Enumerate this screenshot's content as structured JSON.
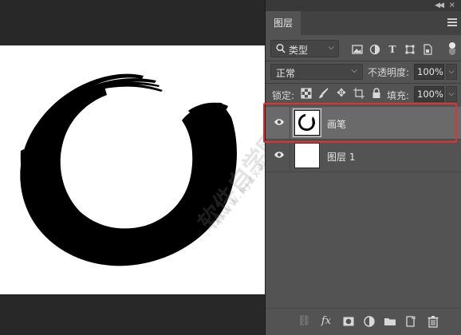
{
  "panel": {
    "tab_label": "图层",
    "filter": {
      "label": "类型"
    },
    "blend_mode": "正常",
    "opacity_label": "不透明度:",
    "opacity_value": "100%",
    "lock_label": "锁定:",
    "fill_label": "填充:",
    "fill_value": "100%",
    "layers": [
      {
        "name": "画笔",
        "selected": true,
        "visible": true
      },
      {
        "name": "图层 1",
        "selected": false,
        "visible": true
      }
    ]
  },
  "icons": {
    "filter": [
      "image-filter-icon",
      "adjustment-filter-icon",
      "type-filter-icon",
      "shape-filter-icon",
      "smart-object-filter-icon"
    ],
    "lock": [
      "lock-transparent-pixels-icon",
      "lock-image-pixels-icon",
      "lock-position-icon",
      "lock-artboard-icon",
      "lock-all-icon"
    ],
    "bottom": [
      "link-layers-icon",
      "layer-style-icon",
      "add-mask-icon",
      "adjustment-layer-icon",
      "new-group-icon",
      "new-layer-icon",
      "delete-layer-icon"
    ]
  },
  "watermark": {
    "text": "软件自学网",
    "sub": "WWW.RJZXW.COM"
  },
  "colors": {
    "highlight": "#e43030",
    "panel": "#535353",
    "selected_row": "#6a6a6a"
  }
}
